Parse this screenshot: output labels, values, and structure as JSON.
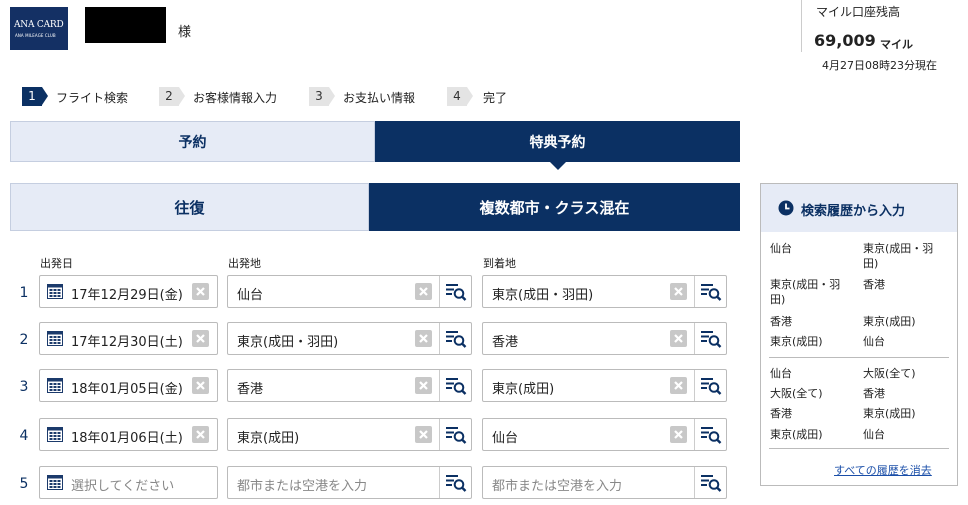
{
  "header": {
    "logo_line1": "ANA CARD",
    "logo_line2": "ANA MILEAGE CLUB",
    "honorific": "様",
    "miles_label": "マイル口座残高",
    "miles_value": "69,009",
    "miles_unit": "マイル",
    "miles_timestamp": "4月27日08時23分現在"
  },
  "steps": [
    {
      "num": "1",
      "label": "フライト検索",
      "active": true
    },
    {
      "num": "2",
      "label": "お客様情報入力",
      "active": false
    },
    {
      "num": "3",
      "label": "お支払い情報",
      "active": false
    },
    {
      "num": "4",
      "label": "完了",
      "active": false
    }
  ],
  "booking_tabs": {
    "reserve": "予約",
    "award": "特典予約"
  },
  "trip_tabs": {
    "round": "往復",
    "multi": "複数都市・クラス混在"
  },
  "columns": {
    "date": "出発日",
    "from": "出発地",
    "to": "到着地"
  },
  "rows": [
    {
      "num": "1",
      "date": "17年12月29日(金)",
      "from": "仙台",
      "to": "東京(成田・羽田)"
    },
    {
      "num": "2",
      "date": "17年12月30日(土)",
      "from": "東京(成田・羽田)",
      "to": "香港"
    },
    {
      "num": "3",
      "date": "18年01月05日(金)",
      "from": "香港",
      "to": "東京(成田)"
    },
    {
      "num": "4",
      "date": "18年01月06日(土)",
      "from": "東京(成田)",
      "to": "仙台"
    },
    {
      "num": "5",
      "date_placeholder": "選択してください",
      "from_placeholder": "都市または空港を入力",
      "to_placeholder": "都市または空港を入力"
    }
  ],
  "history": {
    "title": "検索履歴から入力",
    "group1": [
      {
        "from_l1": "仙台",
        "from_l2": "",
        "to_l1": "東京(成田・羽",
        "to_l2": "田)"
      },
      {
        "from_l1": "東京(成田・羽",
        "from_l2": "田)",
        "to_l1": "香港",
        "to_l2": ""
      },
      {
        "from_l1": "香港",
        "from_l2": "",
        "to_l1": "東京(成田)",
        "to_l2": ""
      },
      {
        "from_l1": "東京(成田)",
        "from_l2": "",
        "to_l1": "仙台",
        "to_l2": ""
      }
    ],
    "group2": [
      {
        "from": "仙台",
        "to": "大阪(全て)"
      },
      {
        "from": "大阪(全て)",
        "to": "香港"
      },
      {
        "from": "香港",
        "to": "東京(成田)"
      },
      {
        "from": "東京(成田)",
        "to": "仙台"
      }
    ],
    "clear_label": "すべての履歴を消去"
  },
  "colors": {
    "navy": "#0b3063",
    "light_tab": "#e6ebf6",
    "link": "#1a4ea8"
  },
  "icons": [
    "calendar-icon",
    "clear-x-icon",
    "search-list-icon",
    "clock-icon"
  ]
}
